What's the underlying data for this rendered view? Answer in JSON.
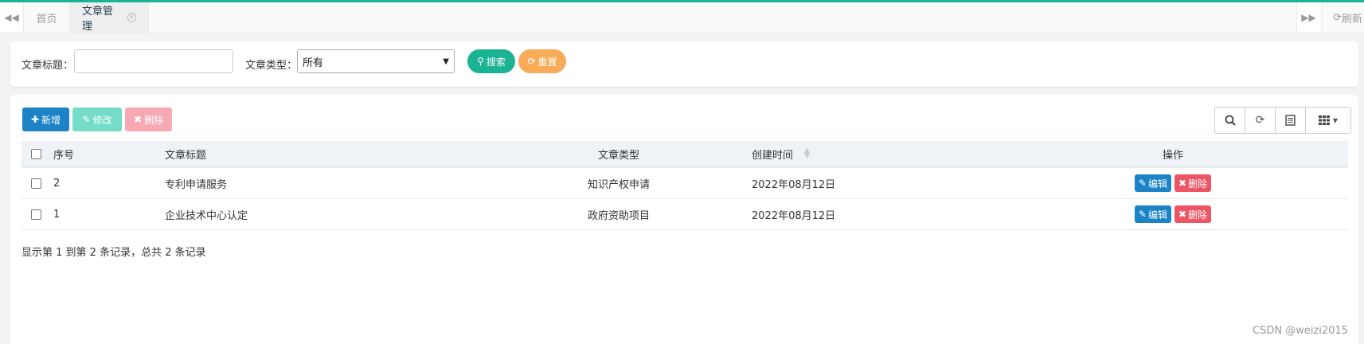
{
  "tabs": {
    "home": "首页",
    "active": "文章管理",
    "refresh": "刷新"
  },
  "search": {
    "title_label": "文章标题：",
    "title_value": "",
    "type_label": "文章类型：",
    "type_selected": "所有",
    "search_btn": "搜索",
    "reset_btn": "重置"
  },
  "actions": {
    "add": "新增",
    "edit": "修改",
    "delete": "删除"
  },
  "table": {
    "headers": {
      "seq": "序号",
      "title": "文章标题",
      "type": "文章类型",
      "time": "创建时间",
      "ops": "操作"
    },
    "rows": [
      {
        "seq": "2",
        "title": "专利申请服务",
        "type": "知识产权申请",
        "time": "2022年08月12日",
        "edit": "编辑",
        "delete": "删除"
      },
      {
        "seq": "1",
        "title": "企业技术中心认定",
        "type": "政府资助项目",
        "time": "2022年08月12日",
        "edit": "编辑",
        "delete": "删除"
      }
    ]
  },
  "pager": {
    "info": "显示第 1 到第 2 条记录，总共 2 条记录"
  },
  "watermark": "CSDN @weizi2015",
  "colors": {
    "primary": "#1c84c6",
    "success": "#1ab394",
    "warning": "#f8ac59",
    "danger": "#ed5565"
  }
}
